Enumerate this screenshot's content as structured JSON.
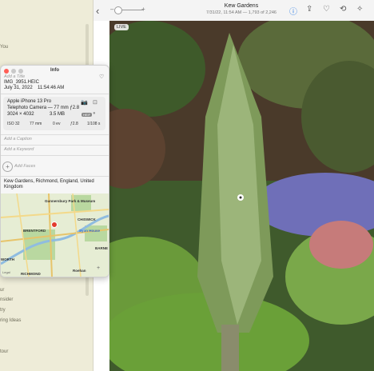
{
  "sidebar": {
    "partial_labels": [
      "You",
      "ur",
      "nsider",
      "try",
      "ring Ideas",
      "tour"
    ]
  },
  "toolbar": {
    "title": "Kew Gardens",
    "subtitle": "7/31/22, 11:54 AM — 1,793 of 2,246",
    "live_badge": "LIVE"
  },
  "info": {
    "window_title": "Info",
    "add_title_placeholder": "Add a Title",
    "filename": "IMG_3951.HEIC",
    "date": "July 31, 2022",
    "time": "11:54:46 AM",
    "camera": "Apple iPhone 13 Pro",
    "lens": "Telephoto Camera — 77 mm ƒ2.8",
    "resolution": "3024 × 4032",
    "file_size": "3.5 MB",
    "format_badge": "HEIF",
    "exif": {
      "iso": "ISO 32",
      "focal": "77 mm",
      "exposure": "0 ev",
      "aperture": "ƒ2.8",
      "shutter": "1/108 s"
    },
    "caption_placeholder": "Add a Caption",
    "keyword_placeholder": "Add a Keyword",
    "faces_label": "Add Faces",
    "location": "Kew Gardens, Richmond, England, United Kingdom"
  },
  "map": {
    "labels": [
      "Gunnersbury Park & Museum",
      "CHISWICK",
      "A4",
      "BRENTFORD",
      "Syon House",
      "BARNE",
      "WORTH",
      "RICHMOND",
      "Roehan"
    ],
    "roads": [
      "A406",
      "A4",
      "A316",
      "A205",
      "A307",
      "A305",
      "M4"
    ],
    "legal": "Legal"
  }
}
